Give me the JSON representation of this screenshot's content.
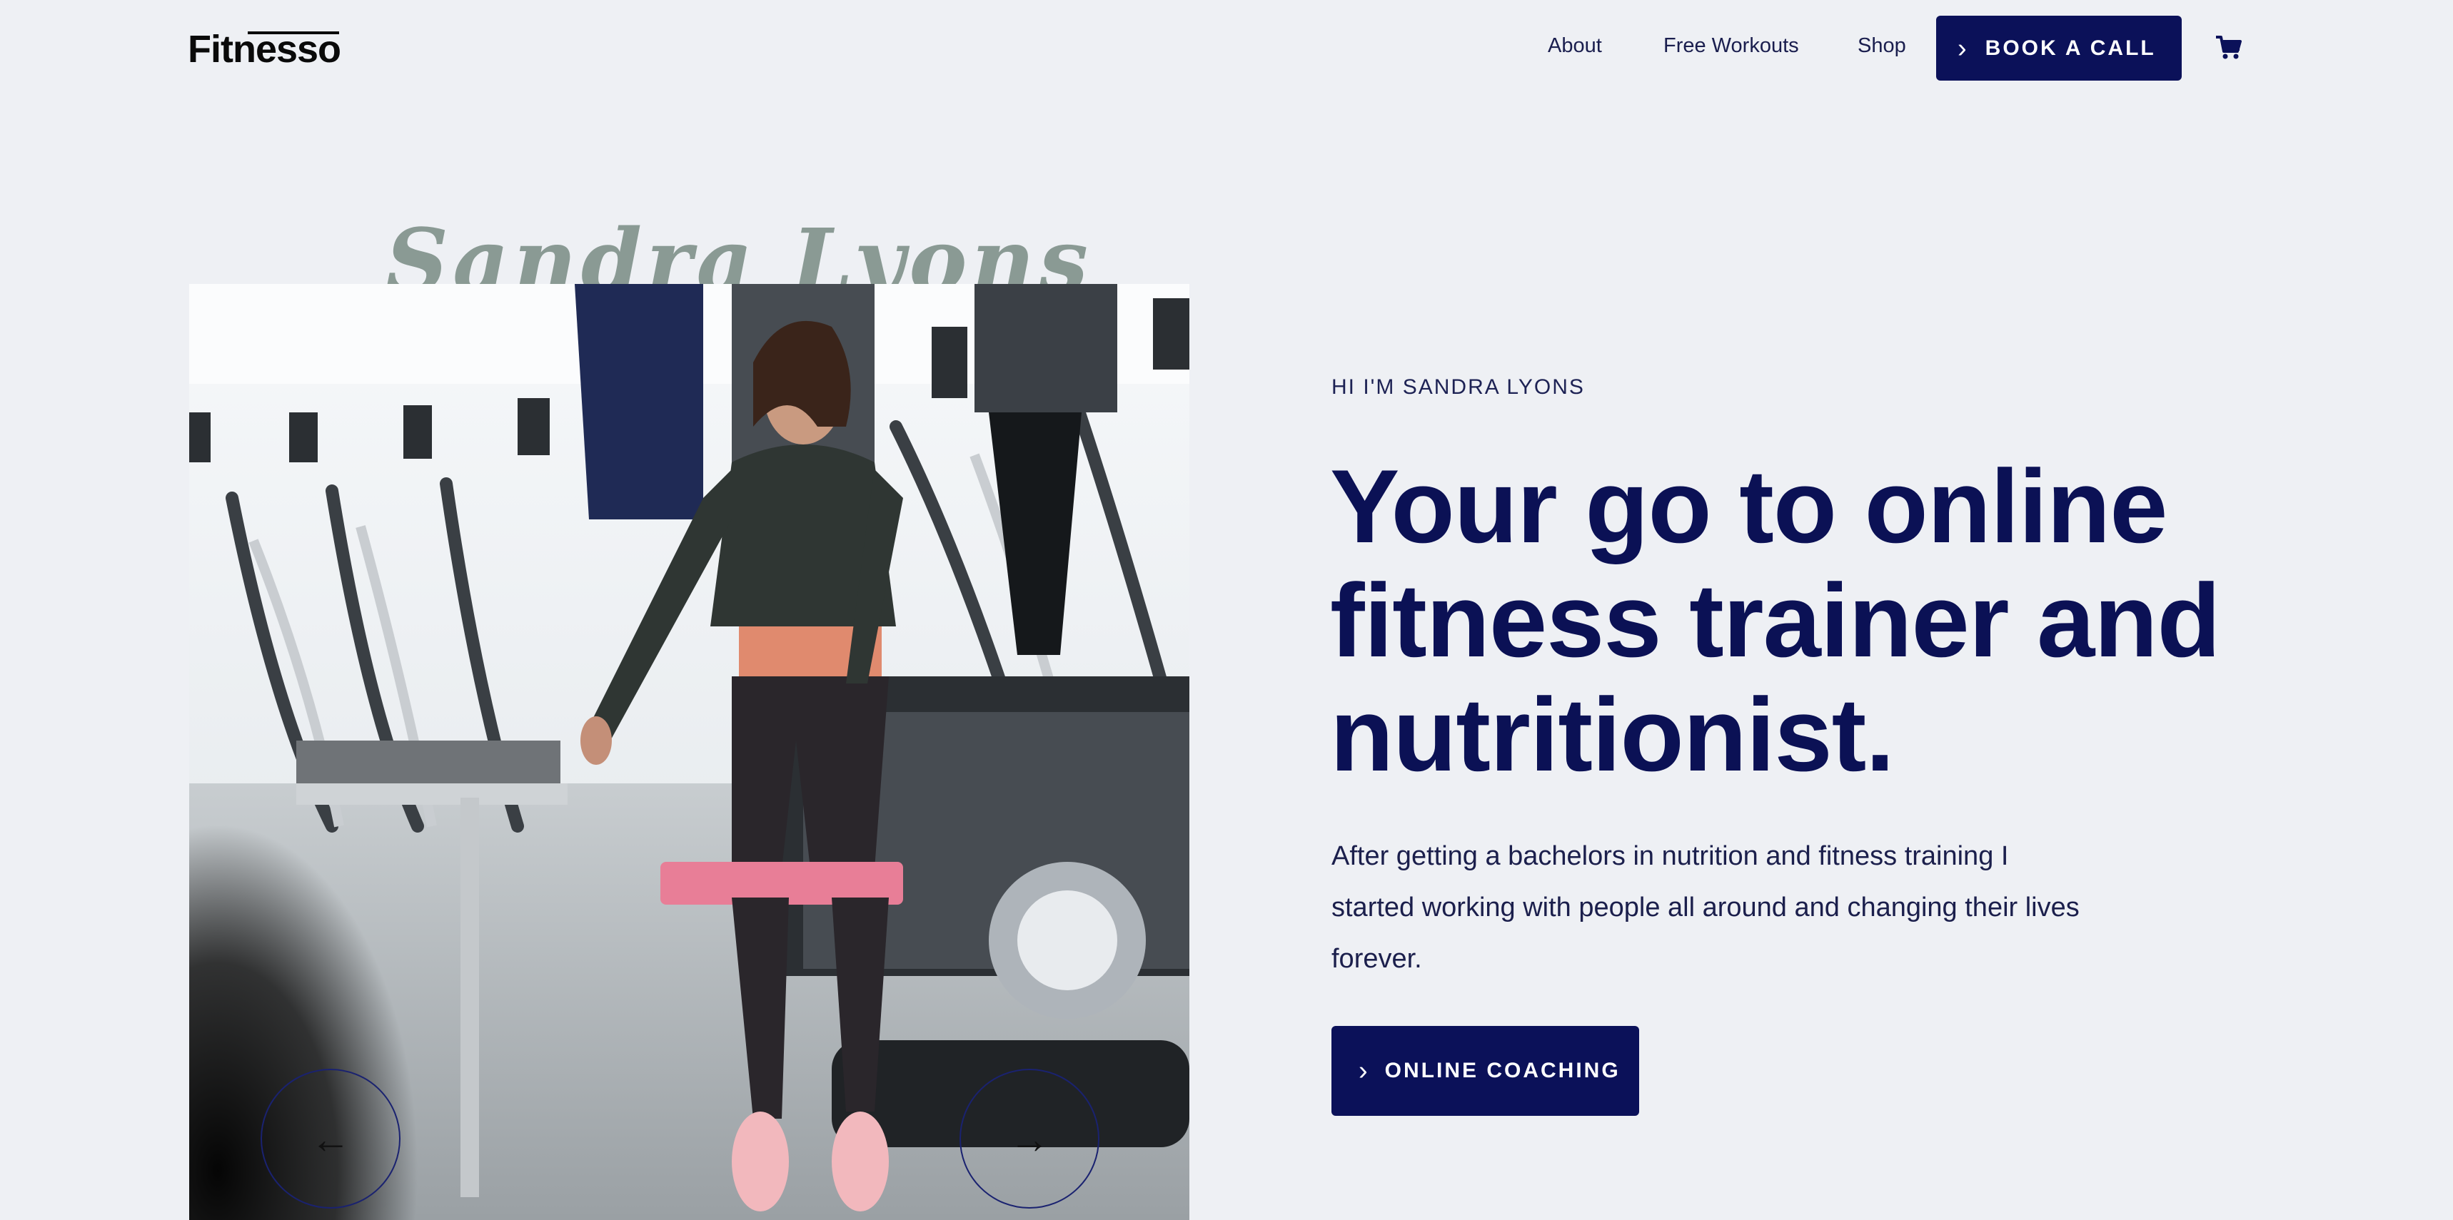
{
  "header": {
    "logo": "Fitnesso",
    "nav": [
      "About",
      "Free Workouts",
      "Shop"
    ],
    "cta": "BOOK A CALL",
    "cart_icon": "cart-icon"
  },
  "hero": {
    "script_name": "Sandra Lyons",
    "eyebrow": "HI I'M SANDRA LYONS",
    "headline": "Your go to online fitness trainer and nutritionist.",
    "paragraph": "After getting a bachelors in nutrition and fitness training I started working with people all around and changing their lives forever.",
    "cta": "ONLINE COACHING",
    "prev_icon": "arrow-left-icon",
    "next_icon": "arrow-right-icon",
    "colors": {
      "primary": "#0b1159",
      "background": "#eef0f4",
      "script": "#8a9a94"
    }
  }
}
